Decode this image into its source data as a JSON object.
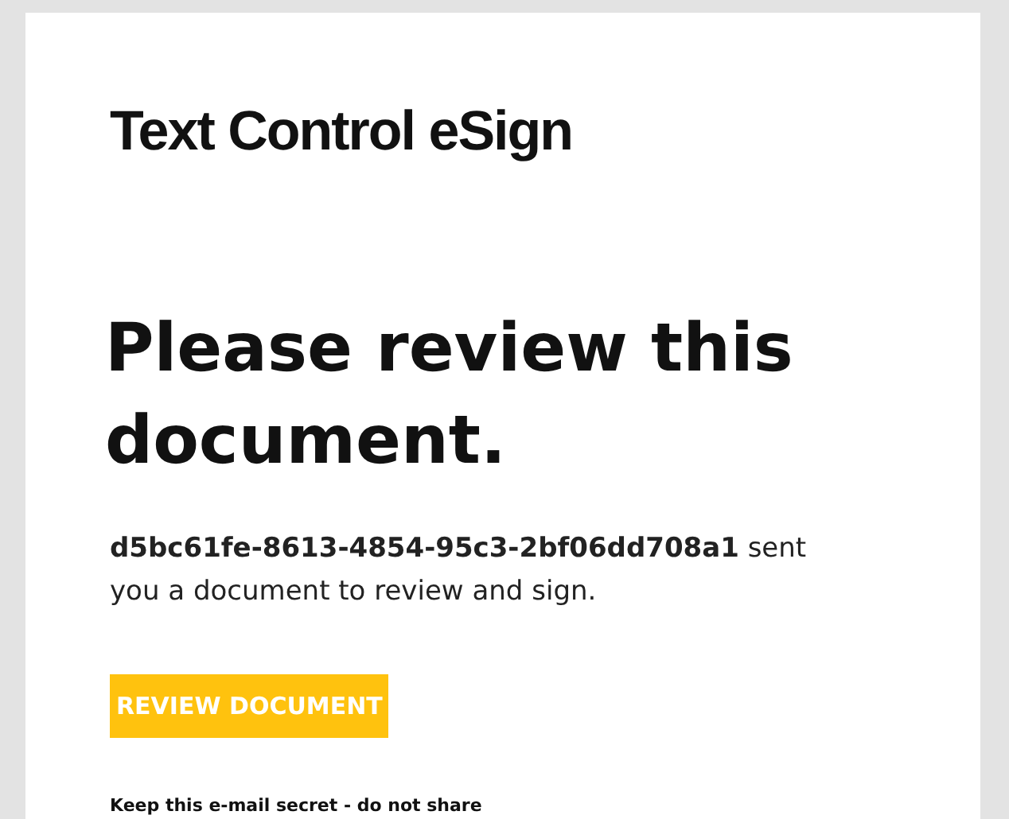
{
  "logo": "Text Control eSign",
  "heading": "Please review this document.",
  "message": "**d5bc61fe-8613-4854-95c3-2bf06dd708a1** sent you a document to review and sign.",
  "button": "REVIEW DOCUMENT",
  "footer": "Keep this e-mail secret - do not share"
}
